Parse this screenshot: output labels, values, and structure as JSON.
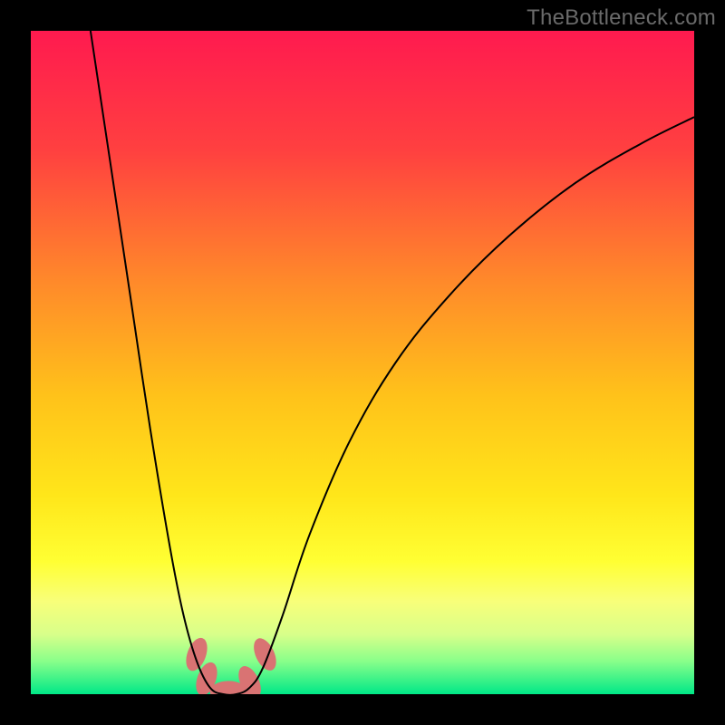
{
  "watermark": "TheBottleneck.com",
  "chart_data": {
    "type": "line",
    "title": "",
    "xlabel": "",
    "ylabel": "",
    "xlim": [
      0,
      100
    ],
    "ylim": [
      0,
      100
    ],
    "grid": false,
    "legend": false,
    "gradient_stops": [
      {
        "offset": 0.0,
        "color": "#ff1a4f"
      },
      {
        "offset": 0.18,
        "color": "#ff4040"
      },
      {
        "offset": 0.38,
        "color": "#ff8a2a"
      },
      {
        "offset": 0.55,
        "color": "#ffc21a"
      },
      {
        "offset": 0.7,
        "color": "#ffe61a"
      },
      {
        "offset": 0.8,
        "color": "#ffff33"
      },
      {
        "offset": 0.86,
        "color": "#f8ff7a"
      },
      {
        "offset": 0.91,
        "color": "#d8ff8a"
      },
      {
        "offset": 0.95,
        "color": "#8aff8a"
      },
      {
        "offset": 1.0,
        "color": "#00e887"
      }
    ],
    "series": [
      {
        "name": "bottleneck-curve",
        "color": "#000000",
        "width": 2,
        "points": [
          {
            "x": 9,
            "y": 100
          },
          {
            "x": 12,
            "y": 80
          },
          {
            "x": 15,
            "y": 60
          },
          {
            "x": 18,
            "y": 40
          },
          {
            "x": 21,
            "y": 22
          },
          {
            "x": 23,
            "y": 12
          },
          {
            "x": 25,
            "y": 5
          },
          {
            "x": 27,
            "y": 1
          },
          {
            "x": 29,
            "y": 0
          },
          {
            "x": 31,
            "y": 0
          },
          {
            "x": 33,
            "y": 1
          },
          {
            "x": 35,
            "y": 4
          },
          {
            "x": 38,
            "y": 12
          },
          {
            "x": 42,
            "y": 24
          },
          {
            "x": 48,
            "y": 38
          },
          {
            "x": 55,
            "y": 50
          },
          {
            "x": 63,
            "y": 60
          },
          {
            "x": 72,
            "y": 69
          },
          {
            "x": 82,
            "y": 77
          },
          {
            "x": 92,
            "y": 83
          },
          {
            "x": 100,
            "y": 87
          }
        ]
      }
    ],
    "markers": [
      {
        "name": "highlight-left-a",
        "cx": 25.0,
        "cy": 6.0,
        "rx": 1.4,
        "ry": 2.6,
        "rot": 20,
        "fill": "#d97373"
      },
      {
        "name": "highlight-left-b",
        "cx": 26.5,
        "cy": 2.3,
        "rx": 1.4,
        "ry": 2.6,
        "rot": 20,
        "fill": "#d97373"
      },
      {
        "name": "highlight-bottom",
        "cx": 29.8,
        "cy": 0.4,
        "rx": 2.8,
        "ry": 1.6,
        "rot": 0,
        "fill": "#d97373"
      },
      {
        "name": "highlight-right-a",
        "cx": 33.0,
        "cy": 1.8,
        "rx": 1.4,
        "ry": 2.6,
        "rot": -25,
        "fill": "#d97373"
      },
      {
        "name": "highlight-right-b",
        "cx": 35.3,
        "cy": 6.0,
        "rx": 1.4,
        "ry": 2.6,
        "rot": -25,
        "fill": "#d97373"
      }
    ]
  }
}
